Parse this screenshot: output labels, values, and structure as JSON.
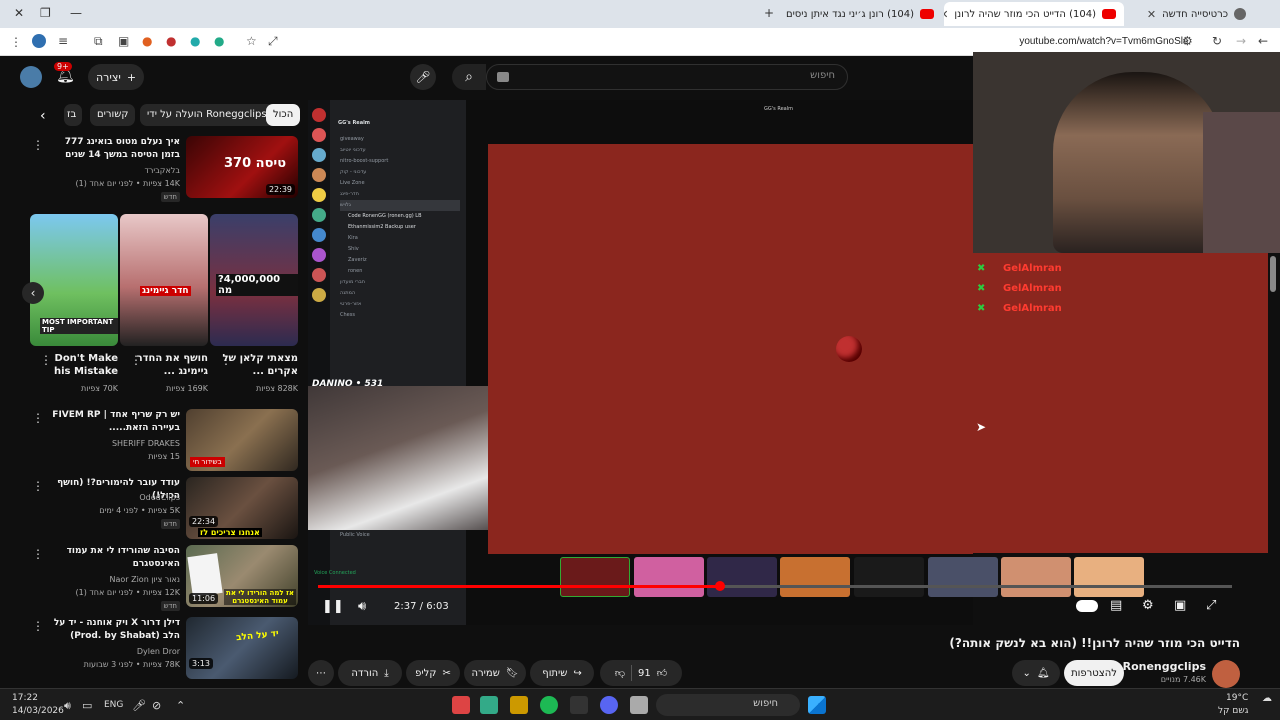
{
  "browser": {
    "tabs": [
      {
        "title": "(104) הדייט הכי מוזר שהיה לרונן"
      },
      {
        "title": "(104) רונן ג׳יני נגד איתן ניסים!!"
      },
      {
        "title": "כרטיסייה חדשה"
      }
    ],
    "url": "youtube.com/watch?v=Tvm6mGnoSls"
  },
  "header": {
    "search_placeholder": "חיפוש",
    "create_label": "יצירה",
    "notif_count": "9+"
  },
  "chips": [
    "הכול",
    "הועלה על ידי Roneggclips",
    "קשורים",
    "בז"
  ],
  "sidebar_videos": [
    {
      "title": "איך נעלם מטוס בואינג 777 בזמן הטיסה במשך 14 שנים",
      "channel": "בלאקבירד",
      "meta": "14K צפיות • לפני יום אחד (1)",
      "badge": "חדש",
      "duration": "22:39",
      "thumb_text": "טיסה 370"
    },
    {
      "title": "יש רק שריף אחד | FIVEM RP בעיירה הזאת.....",
      "channel": "SHERIFF DRAKES",
      "meta": "15 צפיות",
      "badge": "",
      "duration": "",
      "thumb_text": "בשידור חי"
    },
    {
      "title": "עודד עובר להימורים?! (חושף הכול!)",
      "channel": "OdedClips",
      "meta": "5K צפיות • לפני 4 ימים",
      "badge": "חדש",
      "duration": "22:34",
      "thumb_text": "אנחנו צריכים לז"
    },
    {
      "title": "הסיבה שהורידו לי את עמוד האינסטגרם",
      "channel": "נאור ציון Naor Zion",
      "meta": "12K צפיות • לפני יום אחד (1)",
      "badge": "חדש",
      "duration": "11:06",
      "thumb_text": "אז למה הורידו לי את עמוד האינסטגרם"
    },
    {
      "title": "דילן דרור X ויק אוחנה - יד על הלב (Prod. by Shabat)",
      "channel": "Dylen Dror",
      "meta": "78K צפיות • לפני 3 שבועות",
      "badge": "",
      "duration": "3:13",
      "thumb_text": "יד על הלב"
    }
  ],
  "shorts": [
    {
      "title": "מצאתי קלאן של אקרים ...",
      "views": "828K צפיות",
      "thumb_text": "?4,000,000 מה"
    },
    {
      "title": "חושף את החדר גיימינג ...",
      "views": "169K צפיות",
      "thumb_text": "חדר גיימינג"
    },
    {
      "title": "Don't Make his Mistake",
      "views": "70K צפיות",
      "thumb_text": "MOST IMPORTANT TIP"
    }
  ],
  "player": {
    "time_current": "2:37",
    "time_total": "6:03",
    "progress": 0.44,
    "server_name": "GG's Realm",
    "streamer_label": "DANINO • 531",
    "voice_status": "Voice Connected"
  },
  "discord": {
    "channels": [
      "giveaway",
      "עדכוני יוטיוב",
      "nitro-boost-support",
      "עדכוני - קוק",
      "Live Zone",
      "חדר-פינג",
      "גלויש",
      "Code RonenGG (ronen.gg) LB",
      "Ethanmissim2 Backup user",
      "Kira",
      "Shiv",
      "Zaveriz",
      "ronen",
      "חברי מועדון",
      "המתנה",
      "אזור-פרטי",
      "Chess",
      "Public Voice"
    ]
  },
  "chat": [
    {
      "user": "GelAlmran"
    },
    {
      "user": "GelAlmran"
    },
    {
      "user": "GelAlmran"
    }
  ],
  "video": {
    "title": "הדייט הכי מוזר שהיה לרונן!! (הוא בא לנשק אותה?)",
    "channel": "Ronenggclips",
    "subscribers": "7.46K מנויים",
    "subscribe_label": "להצטרפות",
    "likes": "91",
    "share_label": "שיתוף",
    "save_label": "שמירה",
    "clip_label": "קליפ",
    "download_label": "הורדה"
  },
  "taskbar": {
    "search_placeholder": "חיפוש",
    "time": "17:22",
    "date": "14/03/2026",
    "lang": "ENG",
    "weather_temp": "19°C",
    "weather_desc": "גשם קל"
  },
  "colors": {
    "yt_red": "#ff0000",
    "stage_red": "#8b261e",
    "background": "#0f0f0f"
  }
}
